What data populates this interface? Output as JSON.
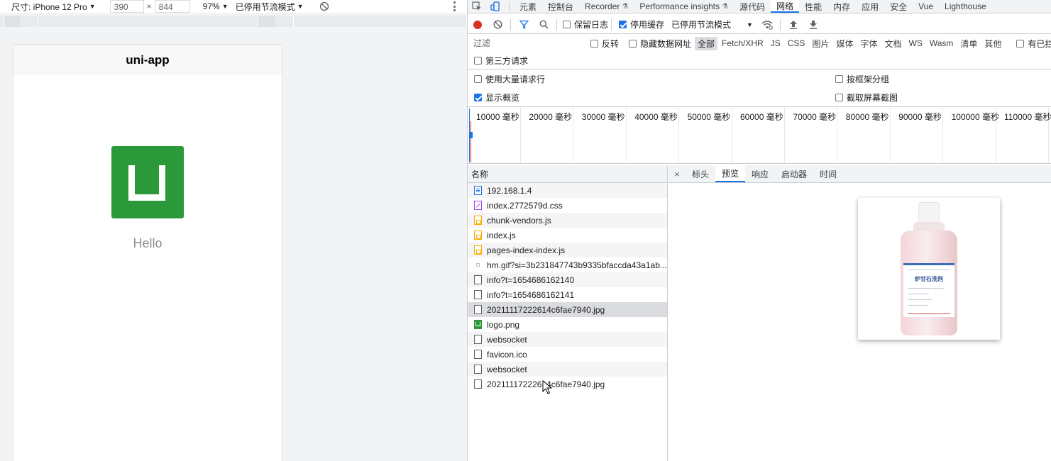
{
  "device_toolbar": {
    "size_label": "尺寸: iPhone 12 Pro",
    "width": "390",
    "times": "×",
    "height": "844",
    "zoom": "97%",
    "throttle": "已停用节流模式"
  },
  "phone": {
    "nav_title": "uni-app",
    "hello": "Hello",
    "logo_color": "#2b9939"
  },
  "devtools": {
    "tabs": [
      {
        "label": "元素"
      },
      {
        "label": "控制台"
      },
      {
        "label": "Recorder"
      },
      {
        "label": "Performance insights"
      },
      {
        "label": "源代码"
      },
      {
        "label": "网络"
      },
      {
        "label": "性能"
      },
      {
        "label": "内存"
      },
      {
        "label": "应用"
      },
      {
        "label": "安全"
      },
      {
        "label": "Vue"
      },
      {
        "label": "Lighthouse"
      }
    ],
    "active_tab": "网络",
    "accent": "#1a73e8"
  },
  "network_toolbar": {
    "preserve_log": "保留日志",
    "disable_cache": "停用缓存",
    "throttle": "已停用节流模式"
  },
  "filter": {
    "placeholder": "过滤",
    "invert": "反转",
    "hide_data_urls": "隐藏数据网址",
    "types": [
      "全部",
      "Fetch/XHR",
      "JS",
      "CSS",
      "图片",
      "媒体",
      "字体",
      "文档",
      "WS",
      "Wasm",
      "清单",
      "其他"
    ],
    "active_type": "全部",
    "blocked": "有已拦截"
  },
  "options": {
    "third_party": "第三方请求",
    "large_rows": "使用大量请求行",
    "group_by_frame": "按框架分组",
    "show_overview": "显示概览",
    "capture_screenshots": "截取屏幕截图"
  },
  "overview": {
    "ticks": [
      "10000 毫秒",
      "20000 毫秒",
      "30000 毫秒",
      "40000 毫秒",
      "50000 毫秒",
      "60000 毫秒",
      "70000 毫秒",
      "80000 毫秒",
      "90000 毫秒",
      "100000 毫秒",
      "110000 毫秒"
    ]
  },
  "requests": {
    "header": "名称",
    "items": [
      {
        "name": "192.168.1.4",
        "type": "doc"
      },
      {
        "name": "index.2772579d.css",
        "type": "css"
      },
      {
        "name": "chunk-vendors.js",
        "type": "js"
      },
      {
        "name": "index.js",
        "type": "js"
      },
      {
        "name": "pages-index-index.js",
        "type": "js"
      },
      {
        "name": "hm.gif?si=3b231847743b9335bfaccda43a1ab...",
        "type": "gif"
      },
      {
        "name": "info?t=1654686162140",
        "type": "other"
      },
      {
        "name": "info?t=1654686162141",
        "type": "other"
      },
      {
        "name": "20211117222614c6fae7940.jpg",
        "type": "other",
        "selected": true
      },
      {
        "name": "logo.png",
        "type": "png"
      },
      {
        "name": "websocket",
        "type": "other"
      },
      {
        "name": "favicon.ico",
        "type": "other"
      },
      {
        "name": "websocket",
        "type": "other"
      },
      {
        "name": "20211117222614c6fae7940.jpg",
        "type": "other"
      }
    ]
  },
  "detail": {
    "close": "×",
    "tabs": [
      "标头",
      "预览",
      "响应",
      "启动器",
      "时间"
    ],
    "active_tab": "预览",
    "bottle_label": "炉甘石洗剂"
  }
}
